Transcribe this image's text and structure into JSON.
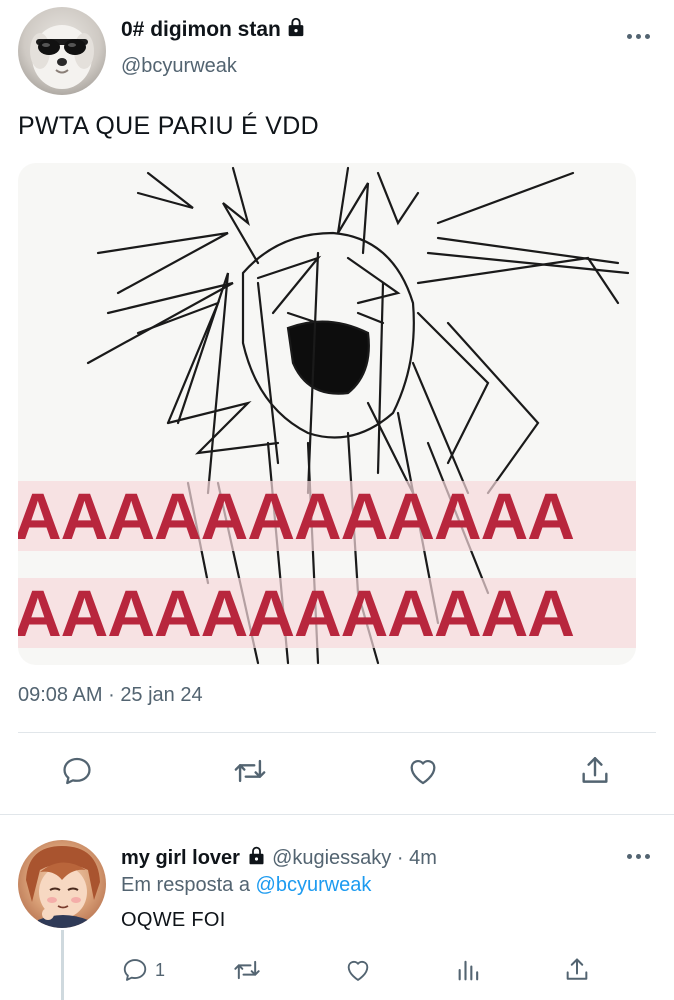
{
  "tweet": {
    "author_name": "0# digimon stan",
    "author_handle": "@bcyurweak",
    "text": "PWTA QUE PARIU É VDD",
    "image_text": "AAAAAAAAAAAA",
    "time": "09:08 AM",
    "separator": "·",
    "date": "25 jan 24",
    "icons": [
      "reply-icon",
      "retweet-icon",
      "like-icon",
      "share-icon"
    ]
  },
  "reply": {
    "author_name": "my girl lover",
    "author_handle": "@kugiessaky",
    "separator": "·",
    "age": "4m",
    "in_reply_prefix": "Em resposta a",
    "in_reply_handle": "@bcyurweak",
    "text": "OQWE FOI",
    "reply_count": "1",
    "icons": [
      "reply-icon",
      "retweet-icon",
      "like-icon",
      "stats-icon",
      "share-icon"
    ]
  },
  "colors": {
    "text": "#0f1419",
    "secondary": "#536471",
    "link": "#1d9bf0",
    "divider": "#e1e6ea",
    "meme_letters": "#b8263d"
  }
}
